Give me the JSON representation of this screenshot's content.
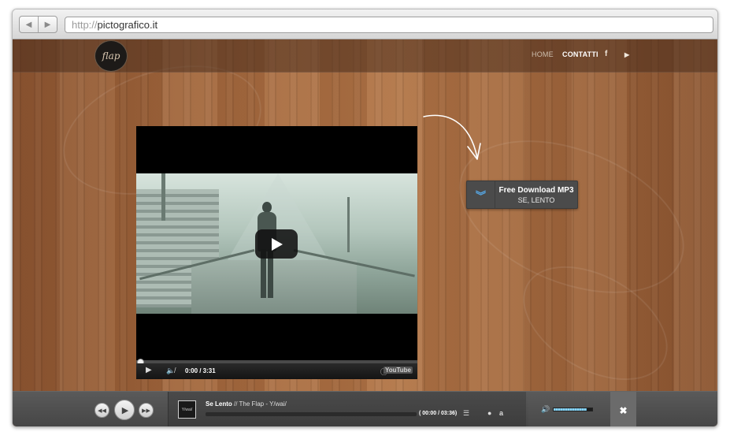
{
  "browser": {
    "url_protocol": "http://",
    "url_host": "pictografico.it"
  },
  "site": {
    "logo_text": "flap",
    "nav": {
      "home": "HOME",
      "contatti": "CONTATTI",
      "facebook": "f",
      "youtube": "▶"
    },
    "video": {
      "time": "0:00 / 3:31",
      "youtube_label": "YouTube"
    },
    "download": {
      "title": "Free Download MP3",
      "subtitle": "SE, LENTO"
    },
    "player": {
      "cover_text": "Y/wai/",
      "track_title": "Se Lento",
      "track_artist": " // The Flap - Y/wai/",
      "time": "( 00:00 / 03:36)",
      "progress": 0.0,
      "volume": 0.85
    }
  },
  "colors": {
    "accent": "#56a8e6",
    "volume_fill": "#8fd2ee"
  },
  "icons": {
    "back": "back-arrow-icon",
    "forward": "forward-arrow-icon",
    "prev": "rewind-icon",
    "play": "play-icon",
    "next": "fast-forward-icon",
    "mute": "mute-icon",
    "info": "info-icon",
    "playlist": "list-icon",
    "apple": "apple-icon",
    "amazon": "amazon-icon",
    "volume": "volume-icon",
    "close": "close-icon",
    "download": "download-chevron-icon"
  }
}
